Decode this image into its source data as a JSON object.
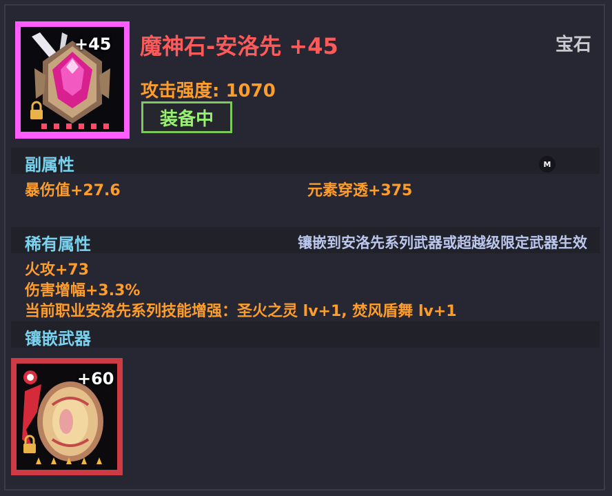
{
  "item": {
    "level_badge": "+45",
    "title": "魔神石-安洛先 +45",
    "category": "宝石",
    "attack": "攻击强度: 1070",
    "equipped_label": "装备中",
    "icon": "gem-icon"
  },
  "sub_attributes": {
    "header": "副属性",
    "stats": [
      "暴伤值+27.6",
      "元素穿透+375"
    ],
    "marker": "M"
  },
  "rare_attributes": {
    "header": "稀有属性",
    "note": "镶嵌到安洛先系列武器或超越级限定武器生效",
    "stats": [
      "火攻+73",
      "伤害增幅+3.3%",
      "当前职业安洛先系列技能增强：圣火之灵 lv+1, 焚风盾舞 lv+1"
    ]
  },
  "inlay_weapon": {
    "header": "镶嵌武器",
    "level_badge": "+60",
    "stars": 5,
    "icon": "shield-weapon-icon"
  },
  "colors": {
    "title": "#ff5a5a",
    "stat": "#ff9d2a",
    "section": "#7ad3ee",
    "equipped": "#98f070"
  }
}
